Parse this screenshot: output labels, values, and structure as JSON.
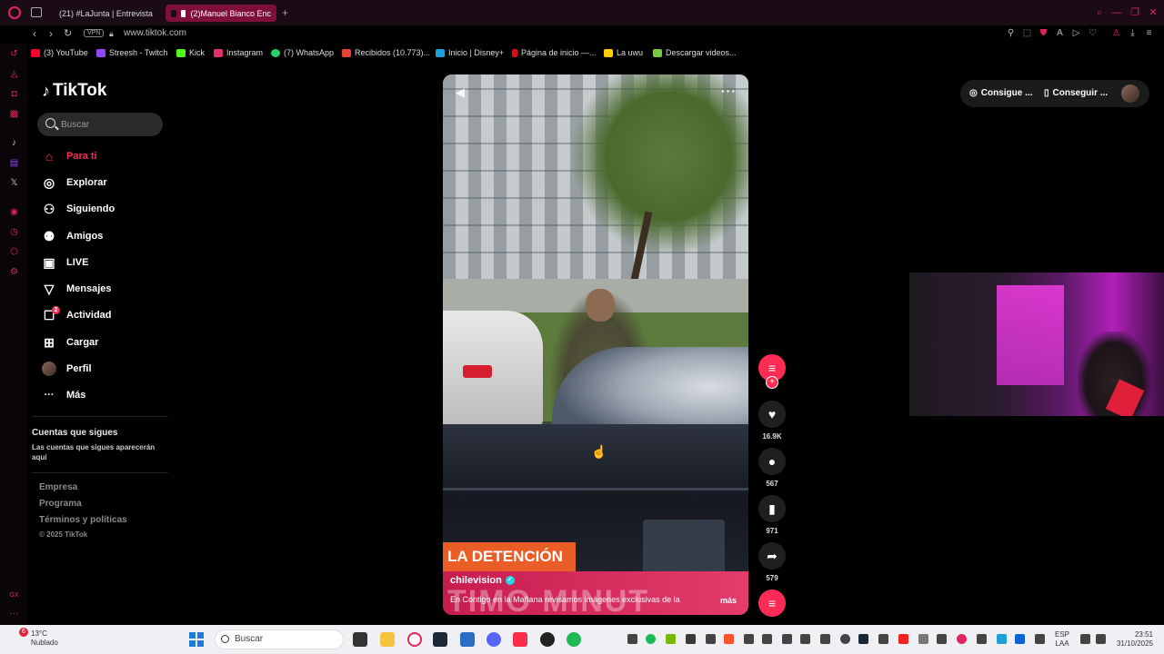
{
  "browser": {
    "tabs": [
      {
        "label": "(21) #LaJunta | Entrevista",
        "color": "#e0245e"
      },
      {
        "label": "(2)Manuel Bianco Enc",
        "color": "#fe2c55"
      }
    ],
    "new_tab": "+",
    "vpn": "VPN",
    "url": "www.tiktok.com",
    "bookmarks": [
      {
        "label": "(3) YouTube",
        "color": "#ff0033"
      },
      {
        "label": "Streesh - Twitch",
        "color": "#9146ff"
      },
      {
        "label": "Kick",
        "color": "#53fc18"
      },
      {
        "label": "Instagram",
        "color": "#e1306c"
      },
      {
        "label": "(7) WhatsApp",
        "color": "#25d366"
      },
      {
        "label": "Recibidos (10.773)...",
        "color": "#ea4335"
      },
      {
        "label": "Inicio | Disney+",
        "color": "#1d9fd8"
      },
      {
        "label": "Página de inicio —...",
        "color": "#e50914"
      },
      {
        "label": "La uwu",
        "color": "#ffcc00"
      },
      {
        "label": "Descargar videos...",
        "color": "#7ac943"
      }
    ]
  },
  "sidebar": {
    "logo": "TikTok",
    "search_placeholder": "Buscar",
    "nav": [
      {
        "label": "Para ti",
        "icon": "home-icon",
        "glyph": "⌂",
        "active": true
      },
      {
        "label": "Explorar",
        "icon": "compass-icon",
        "glyph": "◎"
      },
      {
        "label": "Siguiendo",
        "icon": "user-follow-icon",
        "glyph": "⚇"
      },
      {
        "label": "Amigos",
        "icon": "friends-icon",
        "glyph": "⚉"
      },
      {
        "label": "LIVE",
        "icon": "live-icon",
        "glyph": "▣"
      },
      {
        "label": "Mensajes",
        "icon": "message-icon",
        "glyph": "▽"
      },
      {
        "label": "Actividad",
        "icon": "activity-icon",
        "glyph": "☐",
        "badge": "2"
      },
      {
        "label": "Cargar",
        "icon": "upload-icon",
        "glyph": "⊞"
      },
      {
        "label": "Perfil",
        "icon": "profile-icon",
        "glyph": "●"
      },
      {
        "label": "Más",
        "icon": "more-icon",
        "glyph": "···"
      }
    ],
    "following_title": "Cuentas que sigues",
    "following_text": "Las cuentas que sigues aparecerán aquí",
    "footer": [
      "Empresa",
      "Programa",
      "Términos y políticas",
      "© 2025 TikTok"
    ]
  },
  "video": {
    "headline": "LA DETENCIÓN",
    "banner_text": "TIMO MINUT",
    "author": "chilevision",
    "description": "En Contigo en la Mañana revisamos imágenes exclusivas de la",
    "more": "más"
  },
  "actions": {
    "likes": "16.9K",
    "comments": "567",
    "saves": "971",
    "shares": "579"
  },
  "top_right": {
    "btn1": "Consigue ...",
    "btn2": "Conseguir ..."
  },
  "taskbar": {
    "weather_temp": "13°C",
    "weather_desc": "Nublado",
    "weather_badge": "6",
    "search": "Buscar",
    "lang1": "ESP",
    "lang2": "LAA",
    "time": "23:51",
    "date": "31/10/2025"
  }
}
